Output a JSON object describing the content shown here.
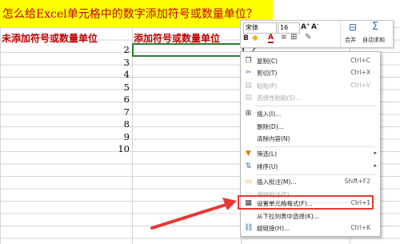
{
  "title": "怎么给Excel单元格中的数字添加符号或数量单位？",
  "headers": {
    "col_a": "未添加符号或数量单位",
    "col_b": "添加符号或数量单位"
  },
  "col_a_values": [
    "2",
    "3",
    "4",
    "5",
    "6",
    "7",
    "8",
    "9",
    "10"
  ],
  "col_b_value": "2",
  "mini_toolbar": {
    "font_name": "宋体",
    "font_size": "16",
    "bold": "B",
    "font_color_label": "A",
    "merge_label": "合并",
    "autosum_label": "自动求和"
  },
  "context_menu": {
    "items": [
      {
        "label": "复制(C)",
        "shortcut": "Ctrl+C",
        "icon": "copy-icon",
        "disabled": false
      },
      {
        "label": "剪切(T)",
        "shortcut": "Ctrl+X",
        "icon": "scissors-icon",
        "disabled": false
      },
      {
        "label": "粘贴(P)",
        "shortcut": "Ctrl+V",
        "icon": "paste-icon",
        "disabled": true
      },
      {
        "label": "选择性粘贴(S)...",
        "shortcut": "",
        "icon": "paste-special-icon",
        "disabled": true
      },
      {
        "label": "插入(I)...",
        "shortcut": "",
        "icon": "insert-icon",
        "disabled": false
      },
      {
        "label": "删除(D)...",
        "shortcut": "",
        "icon": "",
        "disabled": false
      },
      {
        "label": "清除内容(N)",
        "shortcut": "",
        "icon": "",
        "disabled": false
      },
      {
        "label": "筛选(L)",
        "shortcut": "",
        "icon": "filter-icon",
        "disabled": false,
        "submenu": true
      },
      {
        "label": "排序(U)",
        "shortcut": "",
        "icon": "sort-icon",
        "disabled": false,
        "submenu": true
      },
      {
        "label": "插入批注(M)...",
        "shortcut": "Shift+F2",
        "icon": "comment-icon",
        "disabled": false
      },
      {
        "label": "编辑批注(E)...",
        "shortcut": "",
        "icon": "edit-comment-icon",
        "disabled": true
      },
      {
        "label": "设置单元格格式(F)...",
        "shortcut": "Ctrl+1",
        "icon": "format-cells-icon",
        "disabled": false
      },
      {
        "label": "从下拉列表中选择(K)...",
        "shortcut": "",
        "icon": "",
        "disabled": false
      },
      {
        "label": "超链接(H)...",
        "shortcut": "Ctrl+K",
        "icon": "hyperlink-icon",
        "disabled": false
      }
    ]
  },
  "colors": {
    "title_bg": "#ffff00",
    "title_text": "#c00000",
    "highlight": "#e53935",
    "selection": "#2e7d32"
  }
}
